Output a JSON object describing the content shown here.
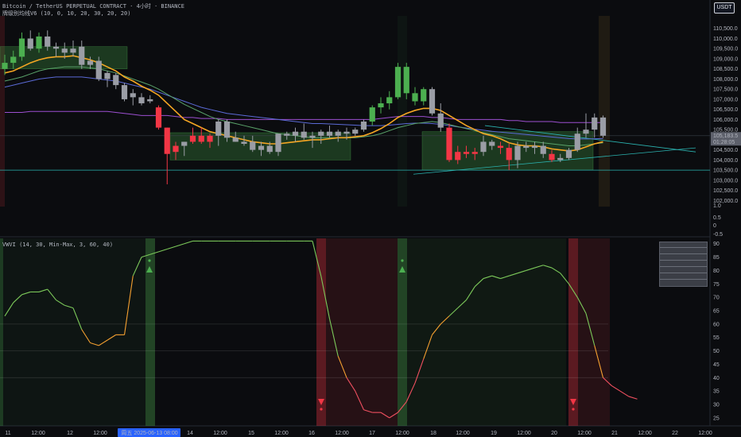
{
  "header": {
    "symbol_line": "Bitcoin / TetherUS PERPETUAL CONTRACT · 4小时 · BINANCE",
    "indicator_line": "牌级别均线V6 (10, 0, 10, 20, 30, 20, 20)",
    "currency_button": "USDT"
  },
  "lower_panel": {
    "label": "VWVI (14, 30, Min-Max, 3, 60, 40)"
  },
  "price_tag": {
    "price": "105,183.5",
    "countdown": "01:28:05"
  },
  "info_box": {
    "rows": [
      "",
      "",
      "",
      "",
      "",
      ""
    ],
    "values": [
      "",
      "",
      "",
      "",
      "",
      ""
    ],
    "colors": [
      "#ef5350",
      "#ef5350",
      "#26a69a",
      "#26a69a",
      "#ef5350",
      "#ef5350"
    ]
  },
  "colors": {
    "up": "#4caf50",
    "down": "#f23645",
    "neutral": "#9a9da5",
    "ema_fast": "#f5a623",
    "ema_mid": "#5aa36a",
    "ema_slow": "#5b6ad6",
    "ema_top": "#9c4fd0",
    "trend": "#2bb3b0",
    "cursor_label": "#2962ff"
  },
  "chart_data": [
    {
      "type": "candlestick",
      "title": "Bitcoin / TetherUS PERPETUAL CONTRACT · 4小时 · BINANCE",
      "y_ticks": [
        102000,
        102500,
        103000,
        103500,
        104000,
        104500,
        105000,
        105500,
        106000,
        106500,
        107000,
        107500,
        108000,
        108500,
        109000,
        109500,
        110000,
        110500
      ],
      "y_tick_labels": [
        "102,000.0",
        "102,500.0",
        "103,000.0",
        "103,500.0",
        "104,000.0",
        "104,500.0",
        "105,000.0",
        "105,500.0",
        "106,000.0",
        "106,500.0",
        "107,000.0",
        "107,500.0",
        "108,000.0",
        "108,500.0",
        "109,000.0",
        "109,500.0",
        "110,000.0",
        "110,500.0"
      ],
      "ylim": [
        101700,
        111000
      ],
      "candles": [
        {
          "o": 108500,
          "h": 109200,
          "l": 108200,
          "c": 108800,
          "dir": "up"
        },
        {
          "o": 108800,
          "h": 109400,
          "l": 108500,
          "c": 109100,
          "dir": "up"
        },
        {
          "o": 109100,
          "h": 110300,
          "l": 108900,
          "c": 110000,
          "dir": "up"
        },
        {
          "o": 110000,
          "h": 110400,
          "l": 109400,
          "c": 109500,
          "dir": "neutral"
        },
        {
          "o": 109500,
          "h": 110300,
          "l": 109300,
          "c": 110100,
          "dir": "up"
        },
        {
          "o": 110100,
          "h": 110400,
          "l": 109400,
          "c": 109600,
          "dir": "neutral"
        },
        {
          "o": 109600,
          "h": 109800,
          "l": 109100,
          "c": 109500,
          "dir": "neutral"
        },
        {
          "o": 109500,
          "h": 109800,
          "l": 109000,
          "c": 109300,
          "dir": "neutral"
        },
        {
          "o": 109300,
          "h": 109900,
          "l": 109100,
          "c": 109500,
          "dir": "neutral"
        },
        {
          "o": 109600,
          "h": 109900,
          "l": 108500,
          "c": 108700,
          "dir": "neutral"
        },
        {
          "o": 108700,
          "h": 109100,
          "l": 108500,
          "c": 108900,
          "dir": "neutral"
        },
        {
          "o": 108900,
          "h": 109100,
          "l": 107900,
          "c": 108000,
          "dir": "neutral"
        },
        {
          "o": 108000,
          "h": 108400,
          "l": 107600,
          "c": 108300,
          "dir": "neutral"
        },
        {
          "o": 108200,
          "h": 108300,
          "l": 107500,
          "c": 107700,
          "dir": "neutral"
        },
        {
          "o": 107700,
          "h": 107800,
          "l": 106900,
          "c": 107000,
          "dir": "neutral"
        },
        {
          "o": 107100,
          "h": 107500,
          "l": 106700,
          "c": 107300,
          "dir": "neutral"
        },
        {
          "o": 107100,
          "h": 107300,
          "l": 106700,
          "c": 106800,
          "dir": "neutral"
        },
        {
          "o": 106900,
          "h": 107200,
          "l": 106800,
          "c": 107000,
          "dir": "neutral"
        },
        {
          "o": 106600,
          "h": 106700,
          "l": 105500,
          "c": 105600,
          "dir": "down"
        },
        {
          "o": 105600,
          "h": 105600,
          "l": 102800,
          "c": 104300,
          "dir": "down"
        },
        {
          "o": 104400,
          "h": 104900,
          "l": 104000,
          "c": 104700,
          "dir": "down"
        },
        {
          "o": 104700,
          "h": 104900,
          "l": 104200,
          "c": 104900,
          "dir": "neutral"
        },
        {
          "o": 104900,
          "h": 105600,
          "l": 104800,
          "c": 105200,
          "dir": "down"
        },
        {
          "o": 105200,
          "h": 105600,
          "l": 104800,
          "c": 104900,
          "dir": "down"
        },
        {
          "o": 104900,
          "h": 105300,
          "l": 104600,
          "c": 105200,
          "dir": "down"
        },
        {
          "o": 105200,
          "h": 106000,
          "l": 104700,
          "c": 105900,
          "dir": "neutral"
        },
        {
          "o": 105900,
          "h": 106000,
          "l": 104900,
          "c": 105100,
          "dir": "neutral"
        },
        {
          "o": 105100,
          "h": 105400,
          "l": 104900,
          "c": 104900,
          "dir": "neutral"
        },
        {
          "o": 104900,
          "h": 105200,
          "l": 104700,
          "c": 104800,
          "dir": "neutral"
        },
        {
          "o": 104900,
          "h": 105200,
          "l": 104400,
          "c": 104500,
          "dir": "neutral"
        },
        {
          "o": 104500,
          "h": 104900,
          "l": 104200,
          "c": 104700,
          "dir": "neutral"
        },
        {
          "o": 104700,
          "h": 104900,
          "l": 104300,
          "c": 104400,
          "dir": "neutral"
        },
        {
          "o": 104400,
          "h": 105200,
          "l": 104200,
          "c": 105300,
          "dir": "neutral"
        },
        {
          "o": 105200,
          "h": 105400,
          "l": 105000,
          "c": 105300,
          "dir": "neutral"
        },
        {
          "o": 105200,
          "h": 105600,
          "l": 104900,
          "c": 105400,
          "dir": "neutral"
        },
        {
          "o": 105400,
          "h": 105800,
          "l": 105000,
          "c": 105100,
          "dir": "neutral"
        },
        {
          "o": 105100,
          "h": 105400,
          "l": 104600,
          "c": 105200,
          "dir": "neutral"
        },
        {
          "o": 105200,
          "h": 105500,
          "l": 104800,
          "c": 105400,
          "dir": "neutral"
        },
        {
          "o": 105400,
          "h": 105700,
          "l": 105100,
          "c": 105200,
          "dir": "neutral"
        },
        {
          "o": 105200,
          "h": 105500,
          "l": 104900,
          "c": 105400,
          "dir": "neutral"
        },
        {
          "o": 105400,
          "h": 105600,
          "l": 105000,
          "c": 105300,
          "dir": "neutral"
        },
        {
          "o": 105300,
          "h": 105600,
          "l": 105200,
          "c": 105500,
          "dir": "neutral"
        },
        {
          "o": 105500,
          "h": 106000,
          "l": 105400,
          "c": 105900,
          "dir": "neutral"
        },
        {
          "o": 105900,
          "h": 106700,
          "l": 105700,
          "c": 106600,
          "dir": "up"
        },
        {
          "o": 106600,
          "h": 107100,
          "l": 106300,
          "c": 106800,
          "dir": "up"
        },
        {
          "o": 106800,
          "h": 107400,
          "l": 106500,
          "c": 107100,
          "dir": "up"
        },
        {
          "o": 107100,
          "h": 108800,
          "l": 107000,
          "c": 108600,
          "dir": "up"
        },
        {
          "o": 108600,
          "h": 108800,
          "l": 107000,
          "c": 107300,
          "dir": "up"
        },
        {
          "o": 107300,
          "h": 107600,
          "l": 106700,
          "c": 106900,
          "dir": "up"
        },
        {
          "o": 106900,
          "h": 107600,
          "l": 106700,
          "c": 107500,
          "dir": "up"
        },
        {
          "o": 107500,
          "h": 107600,
          "l": 106200,
          "c": 106300,
          "dir": "neutral"
        },
        {
          "o": 106300,
          "h": 106800,
          "l": 105400,
          "c": 105600,
          "dir": "neutral"
        },
        {
          "o": 105600,
          "h": 105800,
          "l": 103900,
          "c": 104000,
          "dir": "down"
        },
        {
          "o": 104000,
          "h": 104700,
          "l": 103800,
          "c": 104400,
          "dir": "down"
        },
        {
          "o": 104400,
          "h": 104700,
          "l": 104100,
          "c": 104300,
          "dir": "down"
        },
        {
          "o": 104300,
          "h": 104600,
          "l": 104000,
          "c": 104400,
          "dir": "down"
        },
        {
          "o": 104400,
          "h": 105200,
          "l": 104200,
          "c": 104900,
          "dir": "neutral"
        },
        {
          "o": 104900,
          "h": 105000,
          "l": 104500,
          "c": 104700,
          "dir": "neutral"
        },
        {
          "o": 104700,
          "h": 104900,
          "l": 104300,
          "c": 104600,
          "dir": "down"
        },
        {
          "o": 104600,
          "h": 104800,
          "l": 103500,
          "c": 104000,
          "dir": "down"
        },
        {
          "o": 104000,
          "h": 104900,
          "l": 103600,
          "c": 104700,
          "dir": "neutral"
        },
        {
          "o": 104700,
          "h": 104900,
          "l": 104400,
          "c": 104600,
          "dir": "neutral"
        },
        {
          "o": 104600,
          "h": 104900,
          "l": 104300,
          "c": 104700,
          "dir": "neutral"
        },
        {
          "o": 104700,
          "h": 104900,
          "l": 104100,
          "c": 104300,
          "dir": "neutral"
        },
        {
          "o": 104300,
          "h": 104500,
          "l": 103900,
          "c": 104000,
          "dir": "down"
        },
        {
          "o": 104000,
          "h": 104300,
          "l": 103900,
          "c": 104100,
          "dir": "neutral"
        },
        {
          "o": 104100,
          "h": 104600,
          "l": 104000,
          "c": 104500,
          "dir": "neutral"
        },
        {
          "o": 104500,
          "h": 105600,
          "l": 104400,
          "c": 105300,
          "dir": "neutral"
        },
        {
          "o": 105300,
          "h": 106300,
          "l": 105100,
          "c": 105500,
          "dir": "neutral"
        },
        {
          "o": 105500,
          "h": 106300,
          "l": 105100,
          "c": 106100,
          "dir": "neutral"
        },
        {
          "o": 106100,
          "h": 106200,
          "l": 105100,
          "c": 105200,
          "dir": "neutral"
        }
      ],
      "ema_fast": [
        108300,
        108400,
        108600,
        108800,
        108950,
        109050,
        109100,
        109100,
        109150,
        109050,
        108950,
        108800,
        108600,
        108400,
        108100,
        107900,
        107650,
        107450,
        107200,
        106800,
        106400,
        106000,
        105800,
        105600,
        105400,
        105300,
        105200,
        105100,
        105000,
        104900,
        104850,
        104800,
        104800,
        104850,
        104900,
        104950,
        105000,
        105000,
        105050,
        105100,
        105100,
        105150,
        105200,
        105350,
        105550,
        105800,
        106100,
        106300,
        106450,
        106550,
        106550,
        106450,
        106200,
        105950,
        105700,
        105500,
        105300,
        105200,
        105050,
        104850,
        104750,
        104700,
        104700,
        104650,
        104550,
        104500,
        104450,
        104500,
        104650,
        104800,
        104900
      ],
      "ema_mid": [
        107900,
        108000,
        108100,
        108250,
        108400,
        108500,
        108550,
        108600,
        108600,
        108600,
        108550,
        108500,
        108400,
        108300,
        108150,
        108000,
        107850,
        107700,
        107500,
        107250,
        107000,
        106750,
        106550,
        106350,
        106150,
        106000,
        105900,
        105800,
        105700,
        105600,
        105500,
        105400,
        105300,
        105250,
        105200,
        105150,
        105100,
        105100,
        105100,
        105100,
        105100,
        105100,
        105150,
        105200,
        105300,
        105450,
        105600,
        105700,
        105800,
        105850,
        105900,
        105850,
        105750,
        105650,
        105550,
        105450,
        105350,
        105250,
        105150,
        105050,
        105000,
        104950,
        104900,
        104850,
        104800,
        104750,
        104700,
        104700,
        104750,
        104800,
        104850
      ],
      "ema_slow": [
        107600,
        107700,
        107800,
        107900,
        108000,
        108050,
        108100,
        108100,
        108100,
        108100,
        108050,
        108000,
        107950,
        107900,
        107800,
        107700,
        107600,
        107500,
        107350,
        107200,
        107050,
        106900,
        106750,
        106600,
        106500,
        106400,
        106300,
        106250,
        106200,
        106150,
        106100,
        106050,
        106000,
        105950,
        105900,
        105850,
        105800,
        105800,
        105780,
        105760,
        105740,
        105720,
        105700,
        105700,
        105700,
        105720,
        105760,
        105800,
        105820,
        105820,
        105800,
        105760,
        105700,
        105640,
        105580,
        105520,
        105470,
        105420,
        105380,
        105340,
        105300,
        105260,
        105220,
        105180,
        105140,
        105100,
        105060,
        105040,
        105040,
        105050,
        105060
      ],
      "ema_top": [
        106350,
        106350,
        106350,
        106400,
        106400,
        106400,
        106400,
        106400,
        106400,
        106400,
        106400,
        106400,
        106400,
        106350,
        106300,
        106250,
        106200,
        106200,
        106200,
        106200,
        106150,
        106100,
        106100,
        106050,
        106050,
        106050,
        106000,
        106000,
        106000,
        106000,
        106000,
        106000,
        106000,
        106000,
        106000,
        106000,
        106000,
        106000,
        106000,
        106000,
        106000,
        106000,
        106000,
        106000,
        106050,
        106100,
        106150,
        106150,
        106150,
        106150,
        106100,
        106100,
        106050,
        106000,
        106000,
        106000,
        106000,
        106000,
        106000,
        105950,
        105950,
        105900,
        105900,
        105900,
        105900,
        105850,
        105850,
        105850,
        105850,
        105850,
        105850
      ]
    },
    {
      "type": "line",
      "title": "VWVI (14, 30, Min-Max, 3, 60, 40)",
      "y_ticks": [
        25,
        30,
        35,
        40,
        45,
        50,
        55,
        60,
        65,
        70,
        75,
        80,
        85,
        90
      ],
      "ylim": [
        22,
        92
      ],
      "levels": [
        60,
        50,
        40
      ],
      "values": [
        63,
        68,
        71,
        72,
        72,
        73,
        69,
        67,
        66,
        58,
        53,
        52,
        54,
        56,
        56,
        78,
        85,
        86,
        87,
        88,
        89,
        90,
        91,
        92,
        92,
        93,
        93,
        93,
        93,
        93,
        93,
        93,
        93,
        93,
        93,
        93,
        92,
        78,
        62,
        48,
        40,
        35,
        28,
        27,
        27,
        25,
        27,
        31,
        38,
        47,
        56,
        60,
        63,
        66,
        69,
        74,
        77,
        78,
        77,
        78,
        79,
        80,
        81,
        82,
        81,
        79,
        75,
        70,
        64,
        52,
        40,
        37,
        35,
        33,
        32
      ]
    }
  ],
  "x_axis": {
    "labels": [
      "11",
      "12:00",
      "12",
      "12:00",
      "周五 2025-06-13 08:00",
      "14",
      "12:00",
      "15",
      "12:00",
      "16",
      "12:00",
      "17",
      "12:00",
      "18",
      "12:00",
      "19",
      "12:00",
      "20",
      "12:00",
      "21",
      "12:00",
      "22",
      "12:00"
    ]
  },
  "price_panel_axis": {
    "labels": [
      "1.0",
      "0.5",
      "0",
      "-0.5"
    ]
  }
}
